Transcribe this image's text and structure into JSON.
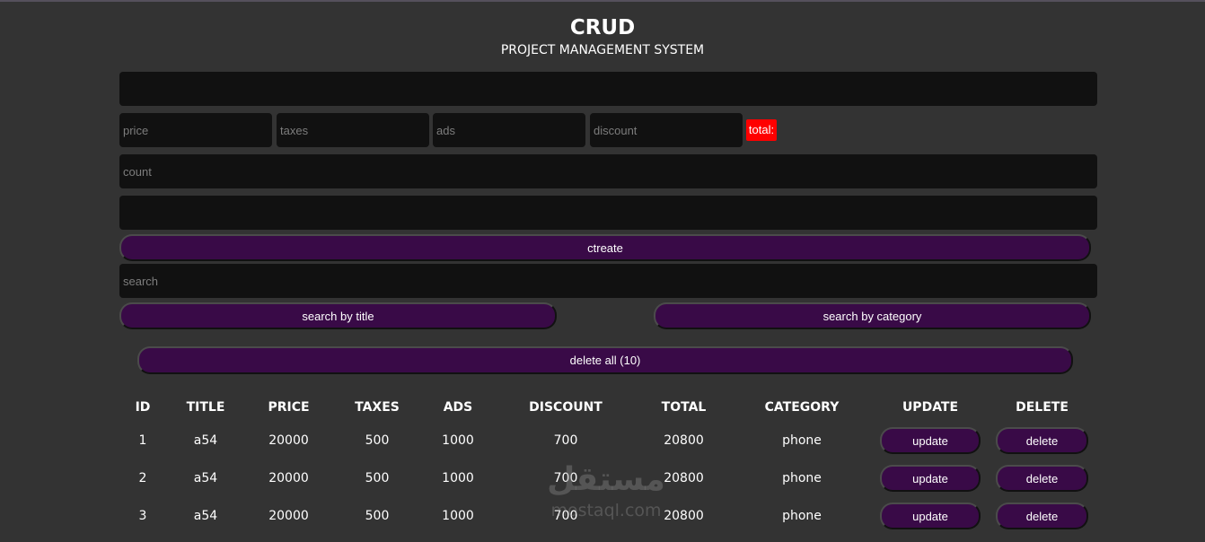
{
  "header": {
    "title": "CRUD",
    "subtitle": "PROJECT MANAGEMENT SYSTEM"
  },
  "form": {
    "title_placeholder": "",
    "price_placeholder": "price",
    "taxes_placeholder": "taxes",
    "ads_placeholder": "ads",
    "discount_placeholder": "discount",
    "total_label": "total:",
    "count_placeholder": "count",
    "category_placeholder": "",
    "create_label": "ctreate",
    "search_placeholder": "search",
    "search_title_label": "search by title",
    "search_category_label": "search by category",
    "delete_all_label": "delete all (10)"
  },
  "table": {
    "headers": [
      "ID",
      "TITLE",
      "PRICE",
      "TAXES",
      "ADS",
      "DISCOUNT",
      "TOTAL",
      "CATEGORY",
      "UPDATE",
      "DELETE"
    ],
    "rows": [
      {
        "id": "1",
        "title": "a54",
        "price": "20000",
        "taxes": "500",
        "ads": "1000",
        "discount": "700",
        "total": "20800",
        "category": "phone",
        "update": "update",
        "delete": "delete"
      },
      {
        "id": "2",
        "title": "a54",
        "price": "20000",
        "taxes": "500",
        "ads": "1000",
        "discount": "700",
        "total": "20800",
        "category": "phone",
        "update": "update",
        "delete": "delete"
      },
      {
        "id": "3",
        "title": "a54",
        "price": "20000",
        "taxes": "500",
        "ads": "1000",
        "discount": "700",
        "total": "20800",
        "category": "phone",
        "update": "update",
        "delete": "delete"
      }
    ]
  },
  "watermark": {
    "arabic": "مستقل",
    "latin": "mostaql.com"
  },
  "colors": {
    "background": "#333333",
    "input_background": "#111111",
    "button_background": "#390a47",
    "total_badge": "#ff0000"
  }
}
